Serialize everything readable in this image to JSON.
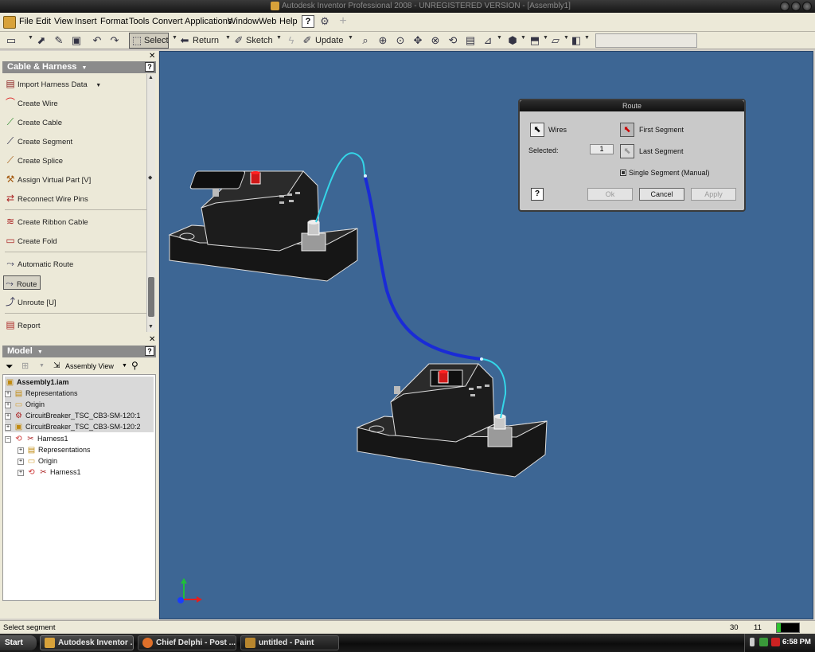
{
  "titlebar": {
    "title": "Autodesk Inventor Professional 2008 - UNREGISTERED VERSION - [Assembly1]"
  },
  "menubar": {
    "items": [
      "File",
      "Edit",
      "View",
      "Insert",
      "Format",
      "Tools",
      "Convert",
      "Applications",
      "Window",
      "Web",
      "Help"
    ]
  },
  "toolbar": {
    "select_label": "Select",
    "return_label": "Return",
    "sketch_label": "Sketch",
    "update_label": "Update"
  },
  "harness_panel": {
    "title": "Cable & Harness",
    "commands": [
      {
        "label": "Import Harness Data",
        "icon": "import-harness-icon"
      },
      {
        "label": "Create Wire",
        "icon": "wire-icon"
      },
      {
        "label": "Create Cable",
        "icon": "cable-icon"
      },
      {
        "label": "Create Segment",
        "icon": "segment-icon"
      },
      {
        "label": "Create Splice",
        "icon": "splice-icon"
      },
      {
        "label": "Assign Virtual Part   [V]",
        "icon": "virtual-part-icon"
      },
      {
        "label": "Reconnect Wire Pins",
        "icon": "reconnect-icon"
      },
      {
        "label": "Create Ribbon Cable",
        "icon": "ribbon-cable-icon"
      },
      {
        "label": "Create Fold",
        "icon": "fold-icon"
      },
      {
        "label": "Automatic Route",
        "icon": "auto-route-icon"
      },
      {
        "label": "Route",
        "icon": "route-icon"
      },
      {
        "label": "Unroute    [U]",
        "icon": "unroute-icon"
      },
      {
        "label": "Report",
        "icon": "report-icon"
      }
    ]
  },
  "model_panel": {
    "title": "Model",
    "view_label": "Assembly View",
    "tree": [
      {
        "label": "Assembly1.iam",
        "level": 0,
        "bold": true
      },
      {
        "label": "Representations",
        "level": 1
      },
      {
        "label": "Origin",
        "level": 1
      },
      {
        "label": "CircuitBreaker_TSC_CB3-SM-120:1",
        "level": 1
      },
      {
        "label": "CircuitBreaker_TSC_CB3-SM-120:2",
        "level": 1
      },
      {
        "label": "Harness1",
        "level": 1
      },
      {
        "label": "Representations",
        "level": 2
      },
      {
        "label": "Origin",
        "level": 2
      },
      {
        "label": "Harness1",
        "level": 2
      }
    ]
  },
  "route_dialog": {
    "title": "Route",
    "wires_label": "Wires",
    "first_segment_label": "First Segment",
    "selected_label": "Selected:",
    "selected_value": "1",
    "last_segment_label": "Last Segment",
    "single_segment_label": "Single Segment (Manual)",
    "ok_label": "Ok",
    "cancel_label": "Cancel",
    "apply_label": "Apply"
  },
  "statusbar": {
    "text": "Select segment",
    "num1": "30",
    "num2": "11"
  },
  "taskbar": {
    "start_label": "Start",
    "tasks": [
      "Autodesk Inventor ...",
      "Chief Delphi - Post ...",
      "untitled - Paint"
    ],
    "clock": "6:58 PM"
  },
  "colors": {
    "viewport": "#3d6694",
    "wire_dark": "#1a2bd6",
    "wire_light": "#34d6e8"
  }
}
